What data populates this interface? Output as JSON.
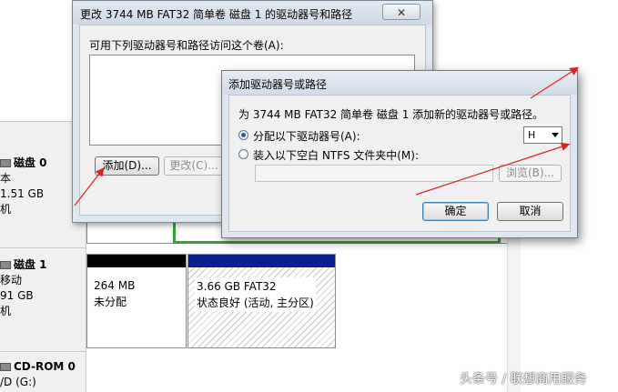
{
  "disk_list": [
    {
      "title": "磁盘 0",
      "lines": [
        "本",
        "1.51 GB",
        "机"
      ]
    },
    {
      "title": "磁盘 1",
      "lines": [
        "移动",
        "91 GB",
        "机"
      ]
    },
    {
      "title": "CD-ROM 0",
      "lines": [
        "/D (G:)"
      ]
    }
  ],
  "partitions": {
    "unallocated": {
      "size": "264 MB",
      "status": "未分配"
    },
    "fat32": {
      "size": "3.66 GB FAT32",
      "status": "状态良好 (活动, 主分区)"
    }
  },
  "dialog_change": {
    "title": "更改 3744 MB FAT32 简单卷 磁盘 1 的驱动器号和路径",
    "close_label": "✕",
    "list_label": "可用下列驱动器号和路径访问这个卷(A):",
    "add_button": "添加(D)...",
    "change_button": "更改(C)..."
  },
  "dialog_add": {
    "title": "添加驱动器号或路径",
    "description": "为 3744 MB FAT32 简单卷 磁盘 1 添加新的驱动器号或路径。",
    "radio_assign": "分配以下驱动器号(A):",
    "drive_letter": "H",
    "radio_mount": "装入以下空白 NTFS 文件夹中(M):",
    "browse_button": "浏览(B)...",
    "ok_button": "确定",
    "cancel_button": "取消"
  },
  "watermark": "头条号 / 联想商用服务",
  "colors": {
    "annotation": "#e02020",
    "primary_partition": "#0a1f8f",
    "unallocated": "#000000",
    "selected_frame": "#3c9e3c"
  }
}
